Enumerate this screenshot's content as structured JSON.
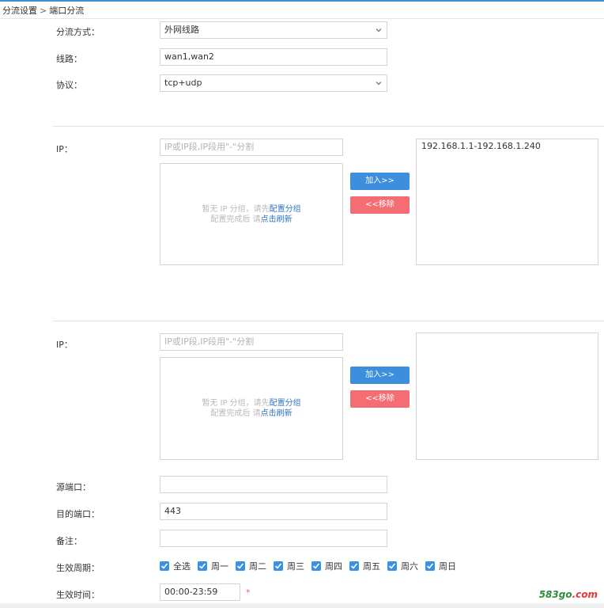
{
  "breadcrumb": {
    "parent": "分流设置",
    "separator": ">",
    "current": "端口分流"
  },
  "form": {
    "mode_label": "分流方式：",
    "mode_value": "外网线路",
    "line_label": "线路：",
    "line_value": "wan1,wan2",
    "protocol_label": "协议：",
    "protocol_value": "tcp+udp"
  },
  "ip_section_1": {
    "label": "IP：",
    "input_placeholder": "IP或IP段,IP段用\"-\"分割",
    "empty_line1_prefix": "暂无 IP 分组，请先",
    "empty_line1_link": "配置分组",
    "empty_line2_prefix": "配置完成后 请",
    "empty_line2_link": "点击刷新",
    "add_label": "加入>>",
    "remove_label": "<<移除",
    "selected": [
      "192.168.1.1-192.168.1.240"
    ]
  },
  "ip_section_2": {
    "label": "IP：",
    "input_placeholder": "IP或IP段,IP段用\"-\"分割",
    "empty_line1_prefix": "暂无 IP 分组，请先",
    "empty_line1_link": "配置分组",
    "empty_line2_prefix": "配置完成后 请",
    "empty_line2_link": "点击刷新",
    "add_label": "加入>>",
    "remove_label": "<<移除",
    "selected": []
  },
  "ports": {
    "src_label": "源端口：",
    "src_value": "",
    "dst_label": "目的端口：",
    "dst_value": "443",
    "note_label": "备注：",
    "note_value": ""
  },
  "schedule": {
    "period_label": "生效周期：",
    "days": [
      {
        "label": "全选",
        "checked": true
      },
      {
        "label": "周一",
        "checked": true
      },
      {
        "label": "周二",
        "checked": true
      },
      {
        "label": "周三",
        "checked": true
      },
      {
        "label": "周四",
        "checked": true
      },
      {
        "label": "周五",
        "checked": true
      },
      {
        "label": "周六",
        "checked": true
      },
      {
        "label": "周日",
        "checked": true
      }
    ],
    "time_label": "生效时间：",
    "time_value": "00:00-23:59",
    "required_mark": "*"
  },
  "watermark": {
    "main": "583go",
    "accent": ".com"
  },
  "colors": {
    "accent": "#3d8ede",
    "danger": "#f46d73",
    "link": "#2f74c0"
  },
  "icons": {
    "select_caret": "chevron-down-icon",
    "checkbox": "checkmark-icon"
  }
}
